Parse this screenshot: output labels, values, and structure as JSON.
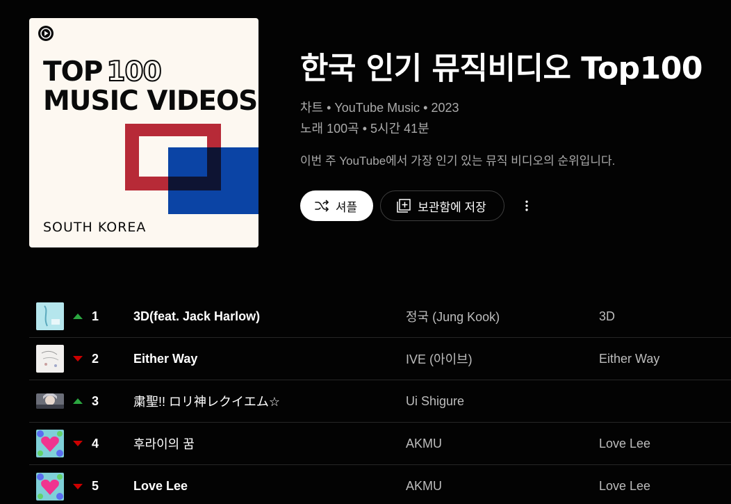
{
  "cover": {
    "title_word": "TOP",
    "title_number": "100",
    "title_line2": "MUSIC VIDEOS",
    "region": "SOUTH KOREA",
    "colors": {
      "red": "#b72a37",
      "blue": "#0b44a5",
      "background": "#fdf8f1"
    }
  },
  "header": {
    "title": "한국 인기 뮤직비디오 Top100",
    "meta_line1": "차트 • YouTube Music • 2023",
    "meta_line2": "노래 100곡 • 5시간 41분",
    "description": "이번 주 YouTube에서 가장 인기 있는 뮤직 비디오의 순위입니다."
  },
  "actions": {
    "shuffle_label": "셔플",
    "save_label": "보관함에 저장",
    "more_icon": "more-vert-icon"
  },
  "tracks": [
    {
      "rank": "1",
      "trend": "up",
      "title": "3D(feat. Jack Harlow)",
      "title_bold": true,
      "artist": "정국 (Jung Kook)",
      "album": "3D"
    },
    {
      "rank": "2",
      "trend": "down",
      "title": "Either Way",
      "title_bold": true,
      "artist": "IVE (아이브)",
      "album": "Either Way"
    },
    {
      "rank": "3",
      "trend": "up",
      "title": "粛聖!! ロリ神レクイエム☆",
      "title_bold": false,
      "artist": "Ui Shigure",
      "album": ""
    },
    {
      "rank": "4",
      "trend": "down",
      "title": "후라이의 꿈",
      "title_bold": false,
      "artist": "AKMU",
      "album": "Love Lee"
    },
    {
      "rank": "5",
      "trend": "down",
      "title": "Love Lee",
      "title_bold": true,
      "artist": "AKMU",
      "album": "Love Lee"
    }
  ],
  "colors": {
    "trend_up": "#2ba640",
    "trend_down": "#cc0000",
    "background": "#030303"
  }
}
